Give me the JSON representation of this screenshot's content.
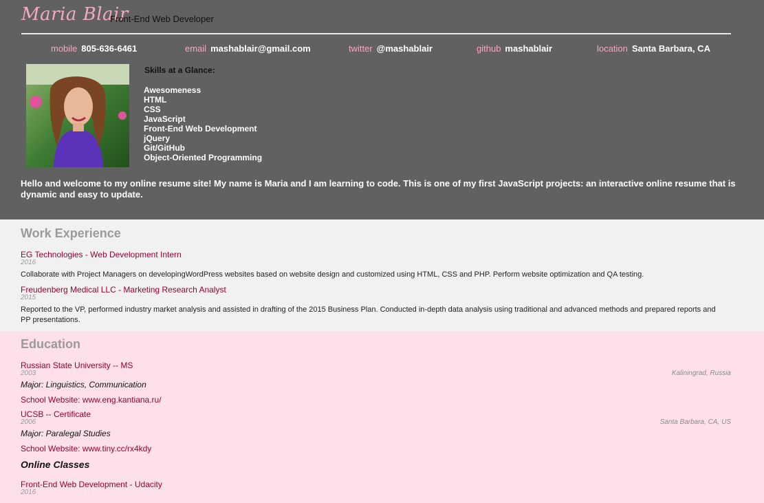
{
  "header": {
    "name": "Maria Blair",
    "role": "Front-End Web Developer"
  },
  "contacts": [
    {
      "key": "mobile",
      "value": "805-636-6461"
    },
    {
      "key": "email",
      "value": "mashablair@gmail.com"
    },
    {
      "key": "twitter",
      "value": "@mashablair"
    },
    {
      "key": "github",
      "value": "mashablair"
    },
    {
      "key": "location",
      "value": "Santa Barbara, CA"
    }
  ],
  "skills": {
    "title": "Skills at a Glance:",
    "items": [
      "Awesomeness",
      "HTML",
      "CSS",
      "JavaScript",
      "Front-End Web Development",
      "jQuery",
      "Git/GitHub",
      "Object-Oriented Programming"
    ]
  },
  "welcome": "Hello and welcome to my online resume site! My name is Maria and I am learning to code. This is one of my first JavaScript projects: an interactive online resume that is dynamic and easy to update.",
  "work": {
    "title": "Work Experience",
    "jobs": [
      {
        "title": "EG Technologies - Web Development Intern",
        "date": "2016",
        "description": "Collaborate with Project Managers on developingWordPress websites based on website design and customized using HTML, CSS and PHP. Perform website optimization and QA testing."
      },
      {
        "title": "Freudenberg Medical LLC - Marketing Research Analyst",
        "date": "2015",
        "description": "Reported to the VP, performed industry market analysis and assisted in drafting of the 2015 Business Plan. Conducted in-depth data analysis using traditional and advanced methods and prepared reports and PP presentations."
      }
    ]
  },
  "education": {
    "title": "Education",
    "schools": [
      {
        "title": "Russian State University -- MS",
        "date": "2003",
        "location": "Kaliningrad, Russia",
        "major": "Major: Linguistics, Communication",
        "site": "School Website: www.eng.kantiana.ru/"
      },
      {
        "title": "UCSB -- Certificate",
        "date": "2006",
        "location": "Santa Barbara, CA, US",
        "major": "Major: Paralegal Studies",
        "site": "School Website: www.tiny.cc/rx4kdy"
      }
    ],
    "online_title": "Online Classes",
    "online": [
      {
        "title": "Front-End Web Development - Udacity",
        "date": "2016"
      }
    ]
  }
}
